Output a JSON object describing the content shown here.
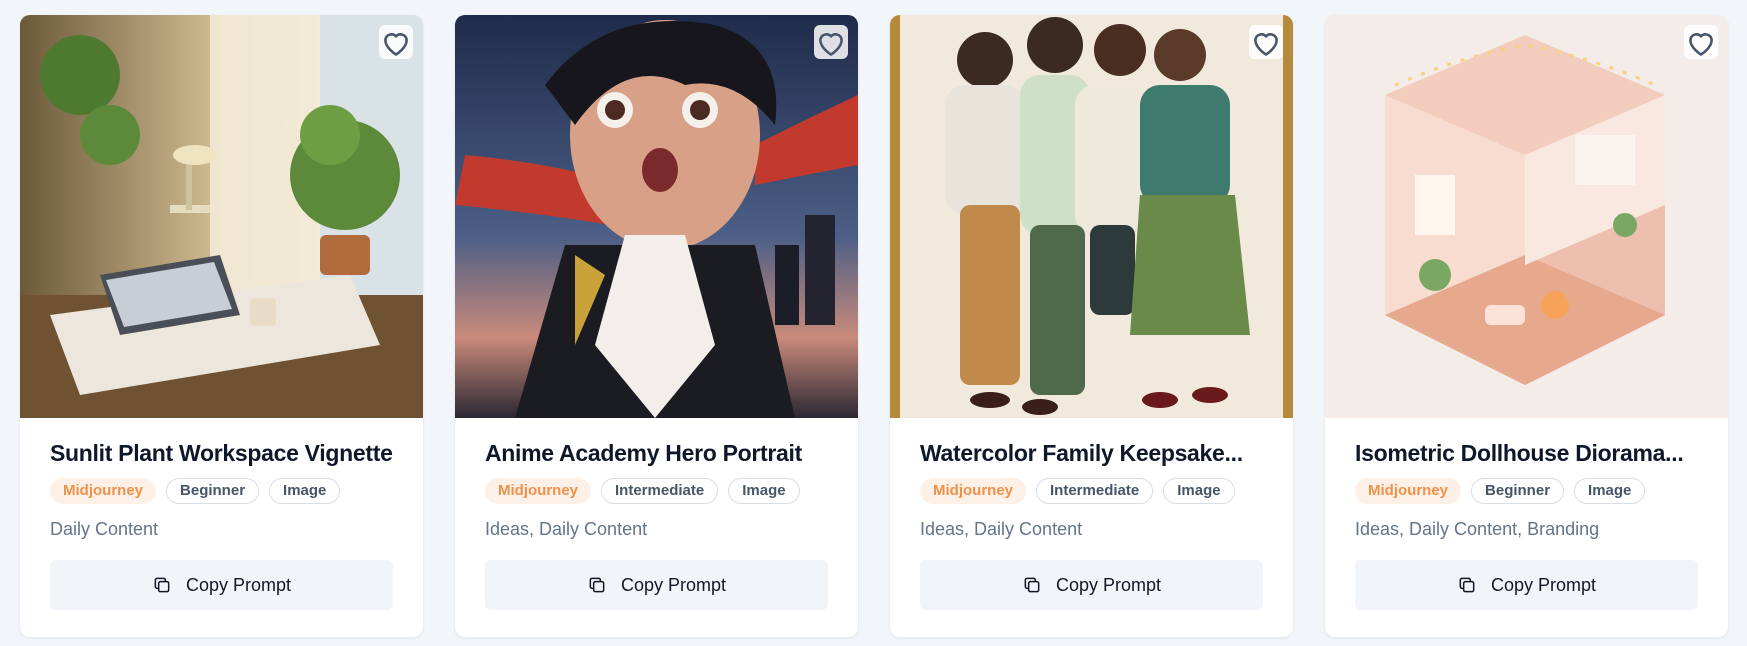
{
  "cards": [
    {
      "title": "Sunlit Plant Workspace Vignette",
      "model_tag": "Midjourney",
      "level_tag": "Beginner",
      "type_tag": "Image",
      "categories": "Daily Content",
      "button_label": "Copy Prompt",
      "image_icon": "plant-workspace-photo"
    },
    {
      "title": "Anime Academy Hero Portrait",
      "model_tag": "Midjourney",
      "level_tag": "Intermediate",
      "type_tag": "Image",
      "categories": "Ideas, Daily Content",
      "button_label": "Copy Prompt",
      "image_icon": "anime-portrait"
    },
    {
      "title": "Watercolor Family Keepsake...",
      "model_tag": "Midjourney",
      "level_tag": "Intermediate",
      "type_tag": "Image",
      "categories": "Ideas, Daily Content",
      "button_label": "Copy Prompt",
      "image_icon": "watercolor-family"
    },
    {
      "title": "Isometric Dollhouse Diorama...",
      "model_tag": "Midjourney",
      "level_tag": "Beginner",
      "type_tag": "Image",
      "categories": "Ideas, Daily Content, Branding",
      "button_label": "Copy Prompt",
      "image_icon": "isometric-dollhouse"
    }
  ],
  "colors": {
    "page_bg": "#f2f6fb",
    "model_tag_bg": "#fdf1e7",
    "model_tag_text": "#f0914a",
    "button_bg": "#f1f4f8"
  }
}
